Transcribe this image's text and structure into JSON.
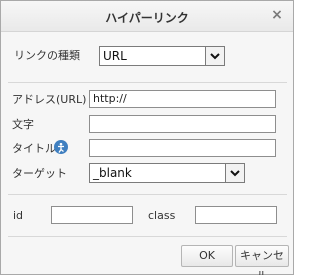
{
  "dialog": {
    "title": "ハイパーリンク",
    "close_glyph": "×"
  },
  "link_type": {
    "label": "リンクの種類",
    "value": "URL"
  },
  "address": {
    "label": "アドレス(URL)",
    "value": "http://"
  },
  "text": {
    "label": "文字",
    "value": ""
  },
  "title_field": {
    "label": "タイトル",
    "value": ""
  },
  "target": {
    "label": "ターゲット",
    "value": "_blank"
  },
  "id_field": {
    "label": "id",
    "value": ""
  },
  "class_field": {
    "label": "class",
    "value": ""
  },
  "buttons": {
    "ok": "OK",
    "cancel": "キャンセル"
  },
  "icons": {
    "close": "close-icon",
    "accessibility": "accessibility-icon",
    "dropdown": "chevron-down-icon"
  }
}
